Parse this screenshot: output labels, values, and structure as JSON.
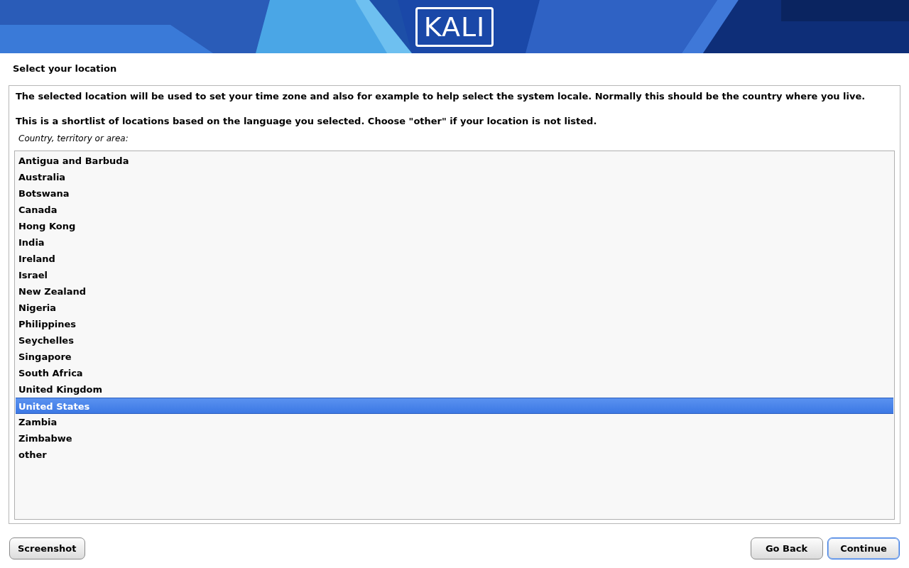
{
  "header": {
    "logo": "KALI"
  },
  "step_title": "Select your location",
  "description": [
    "The selected location will be used to set your time zone and also for example to help select the system locale. Normally this should be the country where you live.",
    "This is a shortlist of locations based on the language you selected. Choose \"other\" if your location is not listed."
  ],
  "list_label": "Country, territory or area:",
  "locations": [
    {
      "label": "Antigua and Barbuda",
      "selected": false
    },
    {
      "label": "Australia",
      "selected": false
    },
    {
      "label": "Botswana",
      "selected": false
    },
    {
      "label": "Canada",
      "selected": false
    },
    {
      "label": "Hong Kong",
      "selected": false
    },
    {
      "label": "India",
      "selected": false
    },
    {
      "label": "Ireland",
      "selected": false
    },
    {
      "label": "Israel",
      "selected": false
    },
    {
      "label": "New Zealand",
      "selected": false
    },
    {
      "label": "Nigeria",
      "selected": false
    },
    {
      "label": "Philippines",
      "selected": false
    },
    {
      "label": "Seychelles",
      "selected": false
    },
    {
      "label": "Singapore",
      "selected": false
    },
    {
      "label": "South Africa",
      "selected": false
    },
    {
      "label": "United Kingdom",
      "selected": false
    },
    {
      "label": "United States",
      "selected": true
    },
    {
      "label": "Zambia",
      "selected": false
    },
    {
      "label": "Zimbabwe",
      "selected": false
    },
    {
      "label": "other",
      "selected": false
    }
  ],
  "buttons": {
    "left": [
      {
        "label": "Screenshot",
        "focused": false
      }
    ],
    "right": [
      {
        "label": "Go Back",
        "focused": false
      },
      {
        "label": "Continue",
        "focused": true
      }
    ]
  }
}
